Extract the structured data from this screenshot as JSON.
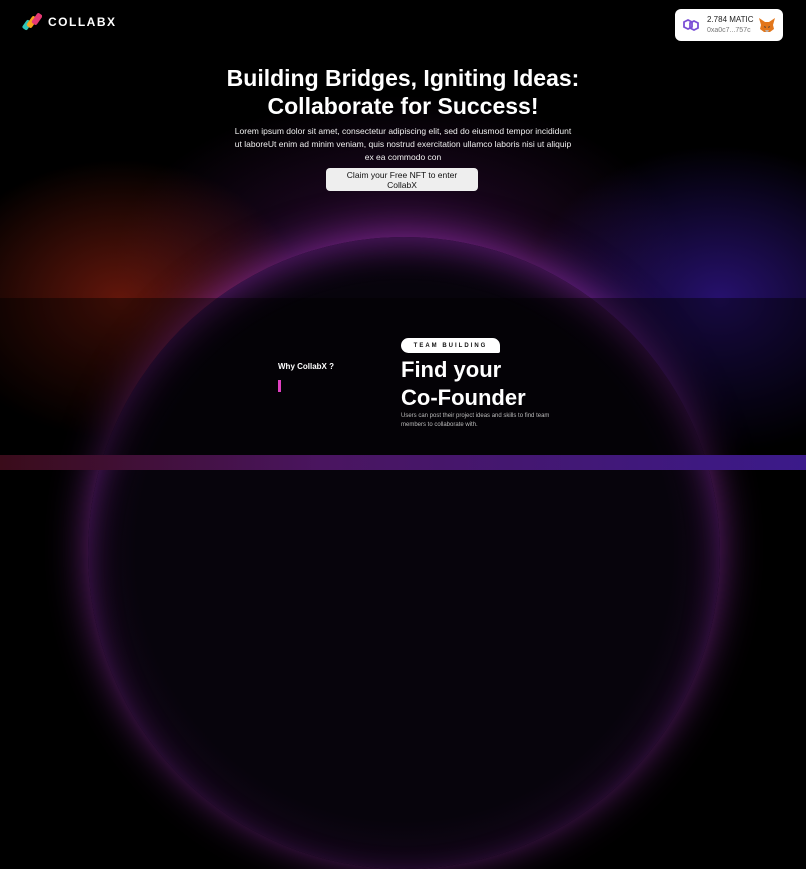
{
  "header": {
    "logo_text": "COLLABX"
  },
  "wallet": {
    "balance": "2.784 MATIC",
    "address": "0xa0c7...757c",
    "network_icon": "polygon-icon",
    "wallet_icon": "metamask-fox-icon"
  },
  "hero": {
    "title_line1": "Building Bridges, Igniting Ideas:",
    "title_line2": "Collaborate for Success!",
    "description": "Lorem ipsum dolor sit amet, consectetur adipiscing elit, sed do eiusmod tempor incididunt ut laboreUt enim ad minim veniam, quis nostrud exercitation ullamco laboris nisi ut aliquip ex ea commodo con",
    "cta_label": "Claim your Free NFT to enter CollabX"
  },
  "features": {
    "section_label": "Why CollabX ?",
    "tag": "TEAM BUILDING",
    "title_line1": "Find your",
    "title_line2": "Co-Founder",
    "description": "Users can post their project ideas and skills to find team members to collaborate with."
  },
  "colors": {
    "accent": "#e040c0",
    "glow_purple": "#b23fd0",
    "glow_red": "#b42814",
    "glow_blue": "#461ec8"
  }
}
